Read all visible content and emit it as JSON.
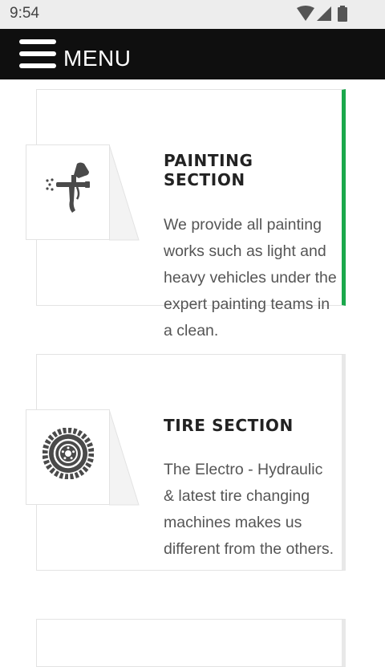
{
  "status_bar": {
    "time": "9:54",
    "icons": [
      "wifi-icon",
      "cellular-signal-icon",
      "battery-icon"
    ]
  },
  "navbar": {
    "menu_label": "MENU",
    "icon": "hamburger-menu-icon"
  },
  "sections": [
    {
      "icon": "spray-gun-icon",
      "title": "PAINTING SECTION",
      "description": "We provide all painting works such as light and heavy vehicles under the expert painting teams in a clean.",
      "accent_color": "#1aa84b"
    },
    {
      "icon": "tire-icon",
      "title": "TIRE SECTION",
      "description": "The Electro - Hydraulic & latest tire changing machines makes us different from the others."
    }
  ],
  "colors": {
    "navbar_bg": "#0f0f0f",
    "accent": "#1aa84b",
    "status_bar_bg": "#ededed"
  }
}
